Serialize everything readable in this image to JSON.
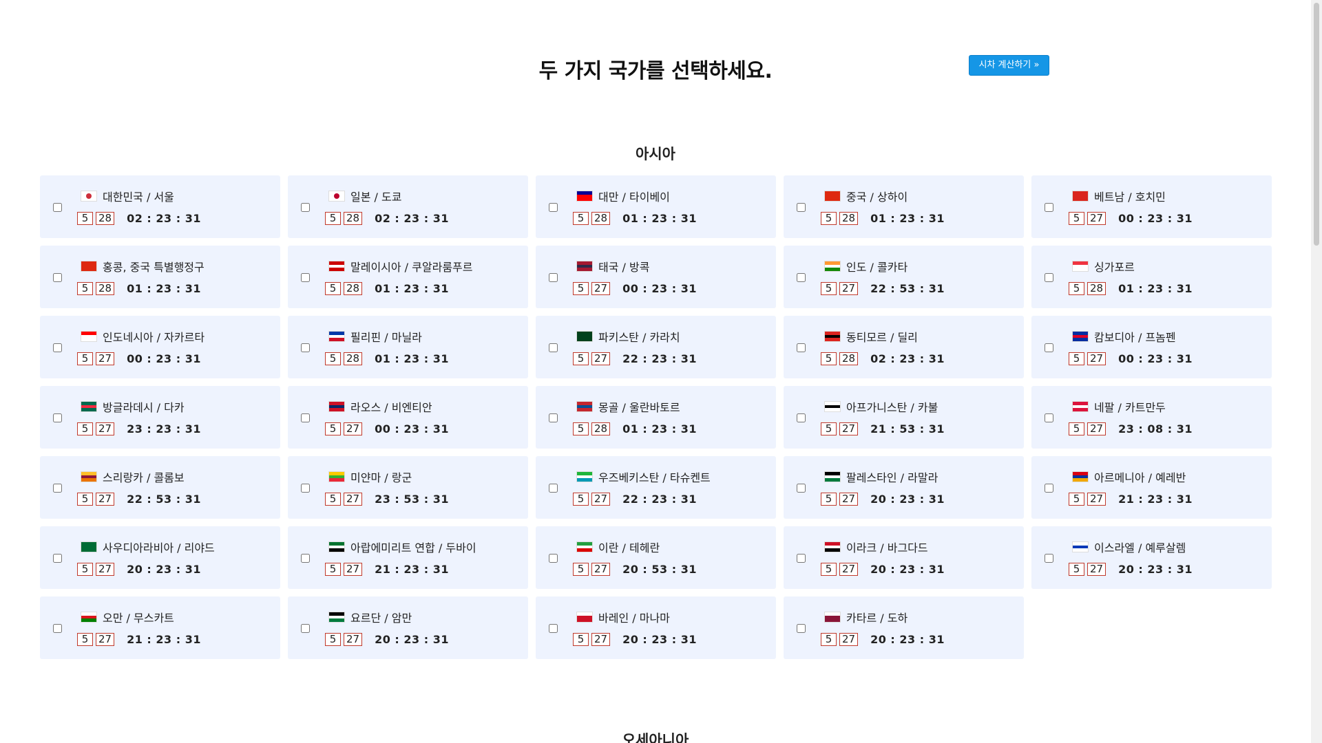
{
  "title": "두 가지 국가를 선택하세요.",
  "calc_button": "시차 계산하기 »",
  "sections": {
    "asia": "아시아",
    "oceania": "오세아니아"
  },
  "countries": [
    {
      "name": "대한민국 / 서울",
      "month": "5",
      "day": "28",
      "time": "02 : 23 : 31",
      "flag": [
        "#ffffff",
        "#ffffff",
        "#ffffff"
      ],
      "flag_mark": "#cd2e3a"
    },
    {
      "name": "일본 / 도쿄",
      "month": "5",
      "day": "28",
      "time": "02 : 23 : 31",
      "flag": [
        "#ffffff",
        "#ffffff",
        "#ffffff"
      ],
      "flag_mark": "#bc002d"
    },
    {
      "name": "대만 / 타이베이",
      "month": "5",
      "day": "28",
      "time": "01 : 23 : 31",
      "flag": [
        "#000095",
        "#fe0000",
        "#fe0000"
      ]
    },
    {
      "name": "중국 / 상하이",
      "month": "5",
      "day": "28",
      "time": "01 : 23 : 31",
      "flag": [
        "#de2910",
        "#de2910",
        "#de2910"
      ]
    },
    {
      "name": "베트남 / 호치민",
      "month": "5",
      "day": "27",
      "time": "00 : 23 : 31",
      "flag": [
        "#da251d",
        "#da251d",
        "#da251d"
      ]
    },
    {
      "name": "홍콩, 중국 특별행정구",
      "month": "5",
      "day": "28",
      "time": "01 : 23 : 31",
      "flag": [
        "#de2910",
        "#de2910",
        "#de2910"
      ]
    },
    {
      "name": "말레이시아 / 쿠알라룸푸르",
      "month": "5",
      "day": "28",
      "time": "01 : 23 : 31",
      "flag": [
        "#cc0001",
        "#ffffff",
        "#cc0001"
      ]
    },
    {
      "name": "태국 / 방콕",
      "month": "5",
      "day": "27",
      "time": "00 : 23 : 31",
      "flag": [
        "#a51931",
        "#2d2a4a",
        "#a51931"
      ]
    },
    {
      "name": "인도 / 콜카타",
      "month": "5",
      "day": "27",
      "time": "22 : 53 : 31",
      "flag": [
        "#ff9933",
        "#ffffff",
        "#138808"
      ]
    },
    {
      "name": "싱가포르",
      "month": "5",
      "day": "28",
      "time": "01 : 23 : 31",
      "flag": [
        "#ef3340",
        "#ffffff",
        "#ffffff"
      ]
    },
    {
      "name": "인도네시아 / 자카르타",
      "month": "5",
      "day": "27",
      "time": "00 : 23 : 31",
      "flag": [
        "#ff0000",
        "#ffffff",
        "#ffffff"
      ]
    },
    {
      "name": "필리핀 / 마닐라",
      "month": "5",
      "day": "28",
      "time": "01 : 23 : 31",
      "flag": [
        "#0038a8",
        "#ffffff",
        "#ce1126"
      ]
    },
    {
      "name": "파키스탄 / 카라치",
      "month": "5",
      "day": "27",
      "time": "22 : 23 : 31",
      "flag": [
        "#01411c",
        "#01411c",
        "#01411c"
      ]
    },
    {
      "name": "동티모르 / 딜리",
      "month": "5",
      "day": "28",
      "time": "02 : 23 : 31",
      "flag": [
        "#dc241f",
        "#000000",
        "#dc241f"
      ]
    },
    {
      "name": "캄보디아 / 프놈펜",
      "month": "5",
      "day": "27",
      "time": "00 : 23 : 31",
      "flag": [
        "#032ea1",
        "#e00025",
        "#032ea1"
      ]
    },
    {
      "name": "방글라데시 / 다카",
      "month": "5",
      "day": "27",
      "time": "23 : 23 : 31",
      "flag": [
        "#006a4e",
        "#f42a41",
        "#006a4e"
      ]
    },
    {
      "name": "라오스 / 비엔티안",
      "month": "5",
      "day": "27",
      "time": "00 : 23 : 31",
      "flag": [
        "#ce1126",
        "#002868",
        "#ce1126"
      ]
    },
    {
      "name": "몽골 / 울란바토르",
      "month": "5",
      "day": "28",
      "time": "01 : 23 : 31",
      "flag": [
        "#c4272f",
        "#015197",
        "#c4272f"
      ]
    },
    {
      "name": "아프가니스탄 / 카불",
      "month": "5",
      "day": "27",
      "time": "21 : 53 : 31",
      "flag": [
        "#ffffff",
        "#000000",
        "#ffffff"
      ]
    },
    {
      "name": "네팔 / 카트만두",
      "month": "5",
      "day": "27",
      "time": "23 : 08 : 31",
      "flag": [
        "#dc143c",
        "#ffffff",
        "#dc143c"
      ]
    },
    {
      "name": "스리랑카 / 콜롬보",
      "month": "5",
      "day": "27",
      "time": "22 : 53 : 31",
      "flag": [
        "#ffbe29",
        "#8d153a",
        "#eb7400"
      ]
    },
    {
      "name": "미얀마 / 랑군",
      "month": "5",
      "day": "27",
      "time": "23 : 53 : 31",
      "flag": [
        "#fecb00",
        "#34b233",
        "#ea2839"
      ]
    },
    {
      "name": "우즈베키스탄 / 타슈켄트",
      "month": "5",
      "day": "27",
      "time": "22 : 23 : 31",
      "flag": [
        "#1eb53a",
        "#ffffff",
        "#0099b5"
      ]
    },
    {
      "name": "팔레스타인 / 라말라",
      "month": "5",
      "day": "27",
      "time": "20 : 23 : 31",
      "flag": [
        "#000000",
        "#ffffff",
        "#007a3d"
      ]
    },
    {
      "name": "아르메니아 / 예레반",
      "month": "5",
      "day": "27",
      "time": "21 : 23 : 31",
      "flag": [
        "#d90012",
        "#0033a0",
        "#f2a800"
      ]
    },
    {
      "name": "사우디아라비아 / 리야드",
      "month": "5",
      "day": "27",
      "time": "20 : 23 : 31",
      "flag": [
        "#006c35",
        "#006c35",
        "#006c35"
      ]
    },
    {
      "name": "아랍에미리트 연합 / 두바이",
      "month": "5",
      "day": "27",
      "time": "21 : 23 : 31",
      "flag": [
        "#00732f",
        "#ffffff",
        "#000000"
      ]
    },
    {
      "name": "이란 / 테헤란",
      "month": "5",
      "day": "27",
      "time": "20 : 53 : 31",
      "flag": [
        "#239f40",
        "#ffffff",
        "#da0000"
      ]
    },
    {
      "name": "이라크 / 바그다드",
      "month": "5",
      "day": "27",
      "time": "20 : 23 : 31",
      "flag": [
        "#ce1126",
        "#ffffff",
        "#000000"
      ]
    },
    {
      "name": "이스라엘 / 예루살렘",
      "month": "5",
      "day": "27",
      "time": "20 : 23 : 31",
      "flag": [
        "#ffffff",
        "#0038b8",
        "#ffffff"
      ]
    },
    {
      "name": "오만 / 무스카트",
      "month": "5",
      "day": "27",
      "time": "21 : 23 : 31",
      "flag": [
        "#ffffff",
        "#db161b",
        "#008000"
      ]
    },
    {
      "name": "요르단 / 암만",
      "month": "5",
      "day": "27",
      "time": "20 : 23 : 31",
      "flag": [
        "#000000",
        "#ffffff",
        "#007a3d"
      ]
    },
    {
      "name": "바레인 / 마나마",
      "month": "5",
      "day": "27",
      "time": "20 : 23 : 31",
      "flag": [
        "#ffffff",
        "#ce1126",
        "#ce1126"
      ]
    },
    {
      "name": "카타르 / 도하",
      "month": "5",
      "day": "27",
      "time": "20 : 23 : 31",
      "flag": [
        "#ffffff",
        "#8a1538",
        "#8a1538"
      ]
    }
  ],
  "colors": {
    "card_bg": "#eef3fe",
    "button_bg": "#1596e6",
    "date_border": "#c0392b"
  }
}
